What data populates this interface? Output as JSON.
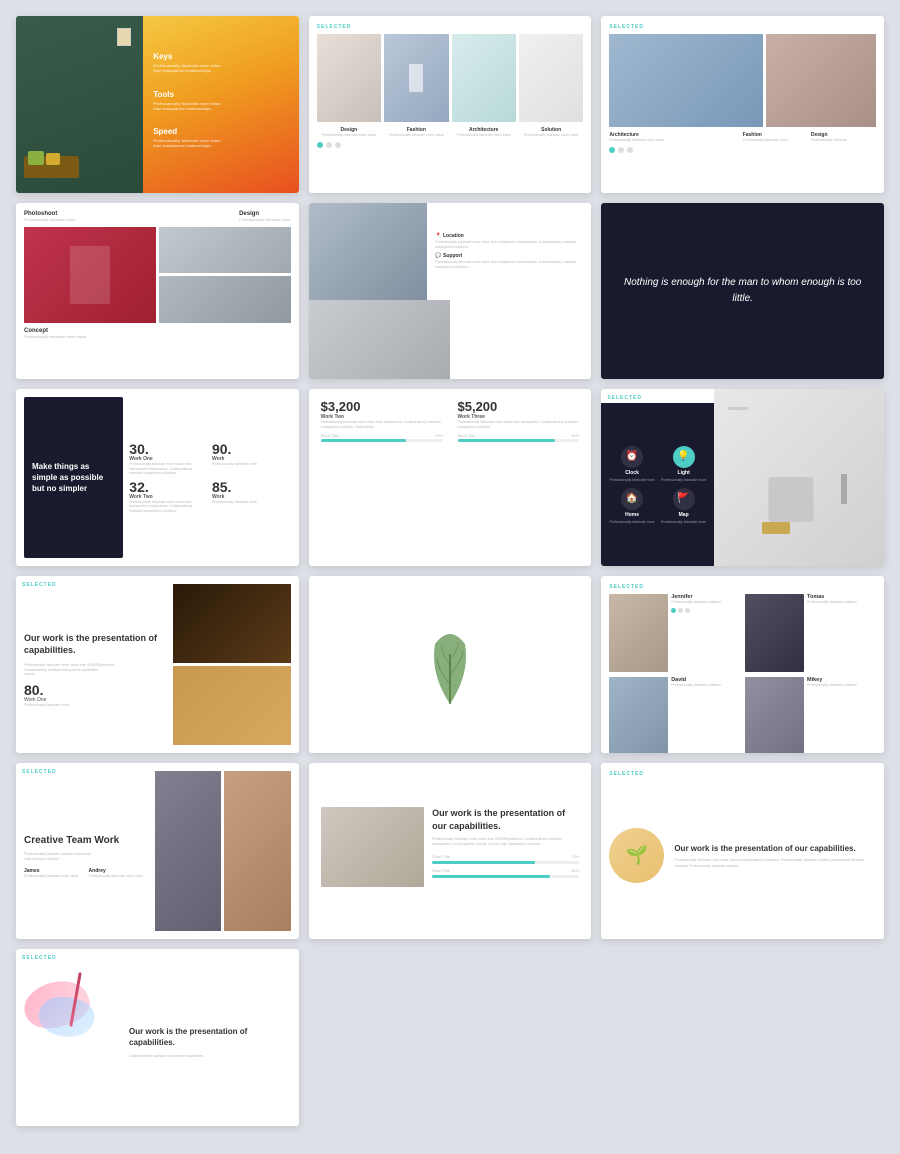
{
  "slides": {
    "slide1": {
      "menu_items": [
        {
          "title": "Keys",
          "desc": "Professionally fabricate more value\nthan transparent relationships."
        },
        {
          "title": "Tools",
          "desc": "Professionally fabricate more value\nthan transparent relationships."
        },
        {
          "title": "Speed",
          "desc": "Professionally fabricate more value\nthan transparent relationships."
        }
      ]
    },
    "slide2": {
      "selected": "SELECTED",
      "captions": [
        {
          "title": "Design",
          "desc": "Professionally fabricate more value"
        },
        {
          "title": "Fashion",
          "desc": "Professionally fabricate more value"
        },
        {
          "title": "Architecture",
          "desc": "Professionally fabricate more value"
        },
        {
          "title": "Solution",
          "desc": "Professionally fabricate more value"
        }
      ]
    },
    "slide3": {
      "selected": "SELECTED",
      "captions": [
        {
          "title": "Architecture",
          "desc": "Professionally fabricate more value"
        },
        {
          "title": "Fashion",
          "desc": "Professionally fabricate more value"
        },
        {
          "title": "Design",
          "desc": "Professionally fabricate more value"
        }
      ]
    },
    "slide4": {
      "captions": [
        {
          "title": "Photoshoot",
          "desc": "Professionally fabricate more"
        },
        {
          "title": "Design",
          "desc": "Professionally fabricate more"
        }
      ],
      "bottom_caption": {
        "title": "Concept",
        "desc": "Professionally fabricate more value"
      }
    },
    "slide5": {
      "services": [
        {
          "icon": "📍",
          "title": "Location",
          "desc": "Professionally fabricate more value than transparent relationships. Collaboratively maintain transparent solutions."
        },
        {
          "icon": "💬",
          "title": "Support",
          "desc": "Professionally fabricate more value than transparent relationships. Collaboratively maintain transparent solutions."
        }
      ]
    },
    "slide6": {
      "quote": "Nothing is enough for\nthe man to whom enough\nis too little."
    },
    "slide7": {
      "quote": "Make things as simple as possible but no simpler",
      "stats": [
        {
          "num": "30.",
          "label": "Work One",
          "desc": "Professionally fabricate more value than\ntransparent relationships. Collaboratively\nmaintain transparent solutions."
        },
        {
          "num": "90.",
          "label": "Work",
          "desc": "Professionally fabricate more"
        },
        {
          "num": "32.",
          "label": "Work Two",
          "desc": "Professionally fabricate more value than\ntransparent relationships. Collaboratively\nmaintain transparent solutions."
        },
        {
          "num": "85.",
          "label": "Work",
          "desc": "Professionally fabricate more"
        }
      ]
    },
    "slide8": {
      "prices": [
        {
          "val": "$3,200",
          "label": "Work Two",
          "desc": "Professionally fabricate more value than\ntransparent. Collaboratively maintain\ntransparent solutions. Distinctively",
          "progress": 70,
          "short": "Short Title",
          "pct": "70%"
        },
        {
          "val": "$5,200",
          "label": "Work Three",
          "desc": "Professionally fabricate more value than\ntransparent. Collaboratively maintain\ntransparent solutions.",
          "progress": 80,
          "short": "Short Title",
          "pct": "80%"
        }
      ]
    },
    "slide9": {
      "selected": "SELECTED",
      "icons": [
        {
          "sym": "⏰",
          "title": "Clock",
          "desc": "Professionally fabricate more"
        },
        {
          "sym": "💡",
          "title": "Light",
          "desc": "Professionally fabricate more",
          "active": true
        },
        {
          "sym": "🏠",
          "title": "Home",
          "desc": "Professionally fabricate more"
        },
        {
          "sym": "🚩",
          "title": "Map",
          "desc": "Professionally fabricate more"
        }
      ]
    },
    "slide10": {
      "selected": "SELECTED",
      "main_text": "Our work is the\npresentation of\ncapabilities.",
      "desc": "Professionally fabricate more value than 000RR0platforms.\nCollaboratively maintain transparent capabilities.\nLabels.",
      "stat": {
        "num": "80.",
        "label": "Work One",
        "desc": "Professionally fabricate more"
      }
    },
    "slide11": {},
    "slide12": {
      "selected": "SELECTED",
      "members": [
        {
          "name": "Jennifer",
          "desc": "Professionally fabricate platform"
        },
        {
          "name": "Tomas",
          "desc": "Professionally fabricate platform"
        },
        {
          "name": "David",
          "desc": "Professionally fabricate platform"
        },
        {
          "name": "Mikey",
          "desc": "Professionally fabricate platform"
        }
      ]
    },
    "slide13": {
      "selected": "SELECTED",
      "title": "Creative\nTeam Work",
      "desc": "Professionally fabricate platform possesses\nsolid inclusive mindset",
      "members": [
        {
          "name": "James",
          "desc": "Professionally fabricate more value"
        },
        {
          "name": "Andrey",
          "desc": "Professionally fabricate more value"
        }
      ]
    },
    "slide14": {
      "main_text": "Our work is the\npresentation of our\ncapabilities.",
      "desc": "Professionally fabricate more value than 000RR0platforms. Collaboratively maintain transparent a a a programs change of more high standards in ventura."
    },
    "slide15": {
      "selected": "SELECTED",
      "main_text": "Our work is the\npresentation of our\ncapabilities.",
      "desc": "Professionally fabricate more value than architecturalimprovisations. Professionally fabricate solution professional fabricate solutions Professionally fabricate solution"
    },
    "slide16": {
      "selected": "SELECTED",
      "main_text": "Our work is the\npresentation of\ncapabilities.",
      "desc": "Collaboratively maintain transparent capabilities."
    }
  }
}
